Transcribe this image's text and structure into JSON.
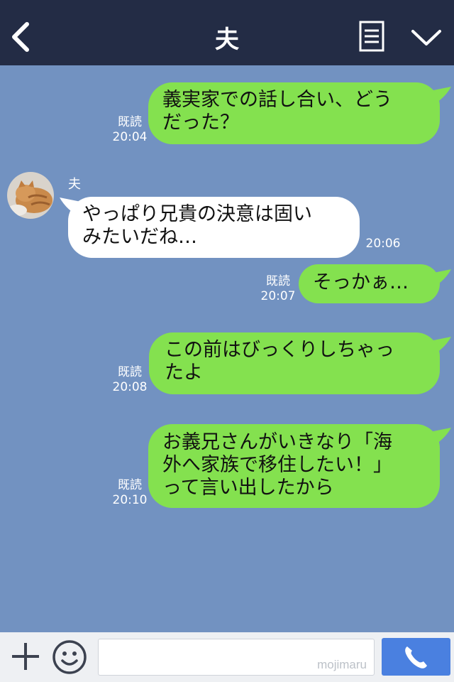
{
  "header": {
    "title": "夫",
    "back_icon": "chevron-left-icon",
    "menu_icon": "note-menu-icon",
    "collapse_icon": "chevron-down-icon",
    "bg_color": "#232c45"
  },
  "chat": {
    "bg_color": "#7292c1",
    "sent_bubble_color": "#84e14f",
    "received_bubble_color": "#ffffff",
    "contact": {
      "name": "夫",
      "avatar": "cat-photo-avatar"
    },
    "messages": [
      {
        "direction": "sent",
        "text": "義実家での話し合い、どう\nだった？",
        "read_label": "既読",
        "time": "20:04"
      },
      {
        "direction": "received",
        "text": "やっぱり兄貴の決意は固い\nみたいだね…",
        "time": "20:06"
      },
      {
        "direction": "sent",
        "text": "そっかぁ…",
        "read_label": "既読",
        "time": "20:07"
      },
      {
        "direction": "sent",
        "text": "この前はびっくりしちゃっ\nたよ",
        "read_label": "既読",
        "time": "20:08"
      },
      {
        "direction": "sent",
        "text": "お義兄さんがいきなり「海\n外へ家族で移住したい！」\nって言い出したから",
        "read_label": "既読",
        "time": "20:10"
      }
    ]
  },
  "footer": {
    "plus_icon": "plus-icon",
    "emoji_icon": "smiley-icon",
    "input_value": "",
    "watermark": "mojimaru",
    "call_icon": "phone-icon",
    "call_color": "#4a80e0"
  }
}
